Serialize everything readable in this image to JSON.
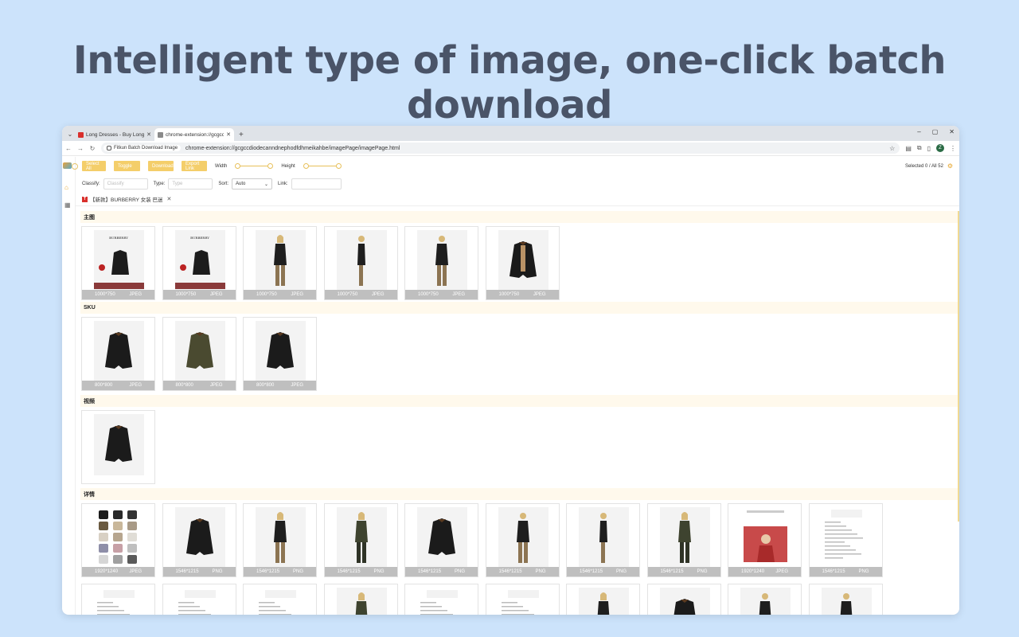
{
  "headline": "Intelligent type of image, one-click batch download",
  "browser": {
    "tabs": [
      {
        "title": "Long Dresses - Buy Long Dre",
        "favicon_color": "#d9302c",
        "active": false
      },
      {
        "title": "chrome-extension://gcgccdi",
        "favicon_color": "#8a8a8a",
        "active": true
      }
    ],
    "new_tab": "+",
    "window_controls": [
      "–",
      "▢",
      "✕"
    ],
    "extension_chip": "Fitkun Batch Download Image",
    "url": "chrome-extension://gcgccdiodecanndnephodfdhmeikahbe/imagePage/imagePage.html",
    "avatar_letter": "Z"
  },
  "toolbar": {
    "buttons": [
      "Select All",
      "Toggle",
      "Download",
      "Export Link"
    ],
    "width_label": "Width",
    "height_label": "Height",
    "selected_count": "Selected 0 / All 52"
  },
  "filters": {
    "classify_label": "Classify:",
    "classify_placeholder": "Classify",
    "type_label": "Type:",
    "type_placeholder": "Type",
    "sort_label": "Sort:",
    "sort_value": "Auto",
    "link_label": "Link:"
  },
  "page_tab": {
    "icon": "T",
    "title": "【新款】BURBERRY 女装 巴迷"
  },
  "sections": [
    {
      "title": "主图",
      "items": [
        {
          "size": "1000*750",
          "format": "JPEG",
          "kind": "banner"
        },
        {
          "size": "1000*750",
          "format": "JPEG",
          "kind": "banner"
        },
        {
          "size": "1000*750",
          "format": "JPEG",
          "kind": "model"
        },
        {
          "size": "1000*750",
          "format": "JPEG",
          "kind": "model-side"
        },
        {
          "size": "1000*750",
          "format": "JPEG",
          "kind": "model-back"
        },
        {
          "size": "1000*750",
          "format": "JPEG",
          "kind": "coat-open"
        }
      ]
    },
    {
      "title": "SKU",
      "items": [
        {
          "size": "800*800",
          "format": "JPEG",
          "kind": "coat-black"
        },
        {
          "size": "800*800",
          "format": "JPEG",
          "kind": "coat-olive"
        },
        {
          "size": "800*800",
          "format": "JPEG",
          "kind": "coat-black"
        }
      ]
    },
    {
      "title": "视频",
      "items": [
        {
          "size": "",
          "format": "",
          "kind": "coat-black"
        }
      ]
    },
    {
      "title": "详情",
      "items": [
        {
          "size": "1920*1240",
          "format": "JPEG",
          "kind": "swatches"
        },
        {
          "size": "1546*1215",
          "format": "PNG",
          "kind": "coat-black"
        },
        {
          "size": "1546*1215",
          "format": "PNG",
          "kind": "model"
        },
        {
          "size": "1546*1215",
          "format": "PNG",
          "kind": "model-olive"
        },
        {
          "size": "1546*1215",
          "format": "PNG",
          "kind": "coat-black"
        },
        {
          "size": "1546*1215",
          "format": "PNG",
          "kind": "model-back"
        },
        {
          "size": "1546*1215",
          "format": "PNG",
          "kind": "model-side"
        },
        {
          "size": "1546*1215",
          "format": "PNG",
          "kind": "model-olive"
        },
        {
          "size": "1920*1240",
          "format": "JPEG",
          "kind": "poster"
        },
        {
          "size": "1546*1215",
          "format": "PNG",
          "kind": "text-doc"
        },
        {
          "size": "",
          "format": "",
          "kind": "text-doc"
        },
        {
          "size": "",
          "format": "",
          "kind": "text-doc"
        },
        {
          "size": "",
          "format": "",
          "kind": "text-doc"
        },
        {
          "size": "",
          "format": "",
          "kind": "model-olive"
        },
        {
          "size": "",
          "format": "",
          "kind": "text-doc"
        },
        {
          "size": "",
          "format": "",
          "kind": "text-doc"
        },
        {
          "size": "",
          "format": "",
          "kind": "model"
        },
        {
          "size": "",
          "format": "",
          "kind": "coat-black"
        },
        {
          "size": "",
          "format": "",
          "kind": "model-back"
        },
        {
          "size": "",
          "format": "",
          "kind": "model-back"
        }
      ]
    }
  ]
}
